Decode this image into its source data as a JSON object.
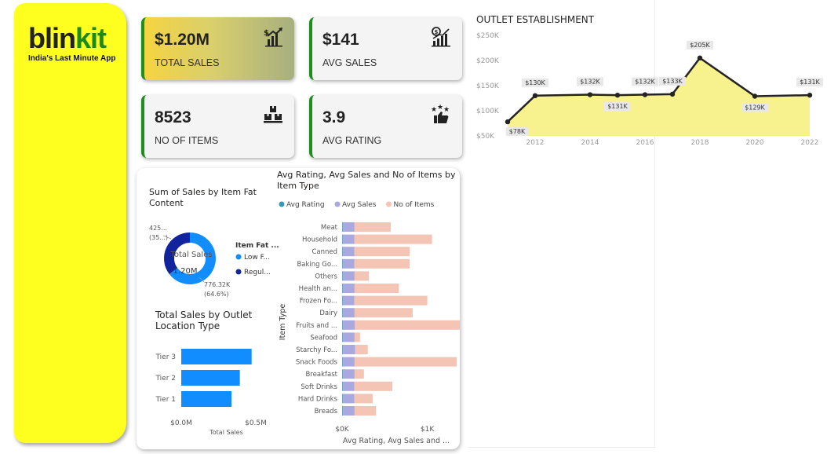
{
  "brand": {
    "name_part1": "blin",
    "name_part2": "kit",
    "tagline": "India's Last Minute App"
  },
  "kpis": [
    {
      "value": "$1.20M",
      "label": "TOTAL SALES",
      "icon": "money-growth-icon"
    },
    {
      "value": "$141",
      "label": "AVG SALES",
      "icon": "dollar-chart-icon"
    },
    {
      "value": "8523",
      "label": "NO OF ITEMS",
      "icon": "boxes-icon"
    },
    {
      "value": "3.9",
      "label": "AVG RATING",
      "icon": "thumbs-up-stars-icon"
    }
  ],
  "colors": {
    "sidebar": "#ffff1f",
    "accent_green": "#1e8f1e",
    "line": "#252423",
    "area": "#f7f28e",
    "donut_low": "#118dff",
    "donut_regular": "#12239e",
    "bar_blue": "#118dff",
    "avg_rating": "#3599b8",
    "avg_sales": "#a9a9e0",
    "no_items": "#f4c5b4"
  },
  "chart_data": [
    {
      "type": "area",
      "title": "OUTLET ESTABLISHMENT",
      "x": [
        2011,
        2012,
        2014,
        2015,
        2016,
        2017,
        2018,
        2020,
        2022
      ],
      "values": [
        78,
        130,
        132,
        131,
        132,
        133,
        205,
        129,
        131
      ],
      "data_labels": [
        "$78K",
        "$130K",
        "$132K",
        "$131K",
        "$132K",
        "$133K",
        "$205K",
        "$129K",
        "$131K"
      ],
      "y_ticks": [
        "$250K",
        "$200K",
        "$150K",
        "$100K",
        "$50K"
      ],
      "x_ticks": [
        "2012",
        "2014",
        "2016",
        "2018",
        "2020",
        "2022"
      ],
      "ylim": [
        50,
        250
      ],
      "xlim": [
        2011,
        2022
      ]
    },
    {
      "type": "pie",
      "title": "Sum of Sales by Item Fat Content",
      "center_label": "Total Sales",
      "center_value": "1.20M",
      "legend_title": "Item Fat ...",
      "slices": [
        {
          "name": "Low F...",
          "value": 776.32,
          "percent": 64.6,
          "label": "776.32K",
          "pct_label": "(64.6%)"
        },
        {
          "name": "Regul...",
          "value": 425.36,
          "percent": 35.4,
          "label": "425...",
          "pct_label": "(35...)"
        }
      ]
    },
    {
      "type": "bar",
      "title": "Total Sales by Outlet Location Type",
      "categories": [
        "Tier 3",
        "Tier 2",
        "Tier 1"
      ],
      "values": [
        0.472,
        0.393,
        0.337
      ],
      "x_ticks": [
        "$0.0M",
        "$0.5M"
      ],
      "xlabel": "Total Sales",
      "xlim": [
        0,
        0.5
      ]
    },
    {
      "type": "bar",
      "title": "Avg Rating, Avg Sales and No of Items by Item Type",
      "legend": [
        "Avg Rating",
        "Avg Sales",
        "No of Items"
      ],
      "categories": [
        "Meat",
        "Household",
        "Canned",
        "Baking Go...",
        "Others",
        "Health an...",
        "Frozen Fo...",
        "Dairy",
        "Fruits and ...",
        "Seafood",
        "Starchy Fo...",
        "Snack Foods",
        "Breakfast",
        "Soft Drinks",
        "Hard Drinks",
        "Breads"
      ],
      "series": [
        {
          "name": "Avg Rating",
          "values": [
            3.9,
            3.9,
            3.9,
            3.9,
            3.9,
            3.9,
            3.9,
            3.9,
            3.9,
            3.9,
            3.9,
            3.9,
            3.9,
            3.9,
            3.9,
            3.9
          ]
        },
        {
          "name": "Avg Sales",
          "values": [
            140,
            140,
            140,
            140,
            141,
            141,
            139,
            141,
            145,
            141,
            148,
            141,
            141,
            139,
            139,
            141
          ]
        },
        {
          "name": "No of Items",
          "values": [
            425,
            910,
            649,
            648,
            169,
            520,
            856,
            682,
            1232,
            64,
            148,
            1200,
            110,
            445,
            214,
            251
          ]
        }
      ],
      "x_ticks": [
        "$0K",
        "$1K"
      ],
      "xlabel": "Avg Rating, Avg Sales and ...",
      "ylabel": "Item Type",
      "xlim": [
        0,
        1400
      ]
    }
  ]
}
